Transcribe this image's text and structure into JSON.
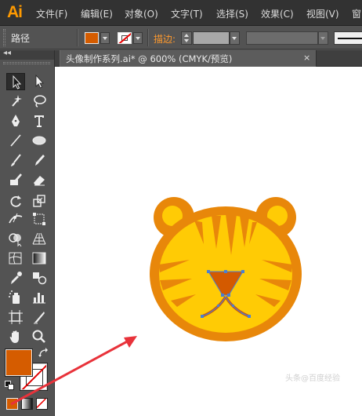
{
  "app": {
    "logo": "Ai"
  },
  "menu": [
    {
      "label": "文件(F)"
    },
    {
      "label": "编辑(E)"
    },
    {
      "label": "对象(O)"
    },
    {
      "label": "文字(T)"
    },
    {
      "label": "选择(S)"
    },
    {
      "label": "效果(C)"
    },
    {
      "label": "视图(V)"
    },
    {
      "label": "窗"
    }
  ],
  "control": {
    "selection_label": "路径",
    "fill_color": "#d55c00",
    "stroke_color": "none",
    "stroke_label": "描边:"
  },
  "document": {
    "tab_title": "头像制作系列.ai* @ 600% (CMYK/预览)",
    "close_glyph": "×"
  },
  "toolbox": {
    "collapse_glyph": "◂◂",
    "fill_color": "#d55c00",
    "stroke_color": "none",
    "tools": [
      "selection-tool-icon",
      "direct-selection-tool-icon",
      "magic-wand-tool-icon",
      "lasso-tool-icon",
      "pen-tool-icon",
      "type-tool-icon",
      "line-segment-tool-icon",
      "ellipse-tool-icon",
      "paintbrush-tool-icon",
      "pencil-tool-icon",
      "blob-brush-tool-icon",
      "eraser-tool-icon",
      "rotate-tool-icon",
      "scale-tool-icon",
      "width-tool-icon",
      "free-transform-tool-icon",
      "shape-builder-tool-icon",
      "perspective-grid-tool-icon",
      "mesh-tool-icon",
      "gradient-tool-icon",
      "eyedropper-tool-icon",
      "blend-tool-icon",
      "symbol-sprayer-tool-icon",
      "column-graph-tool-icon",
      "artboard-tool-icon",
      "slice-tool-icon",
      "hand-tool-icon",
      "zoom-tool-icon"
    ]
  },
  "artwork": {
    "face_outer": "#e8870a",
    "face_inner": "#ffcb05",
    "stripe_color": "#e8870a",
    "nose_color": "#d45a00",
    "anchor_color": "#4a7fd4",
    "arrow_color": "#e8323a"
  },
  "watermark": "头条@百度经验"
}
